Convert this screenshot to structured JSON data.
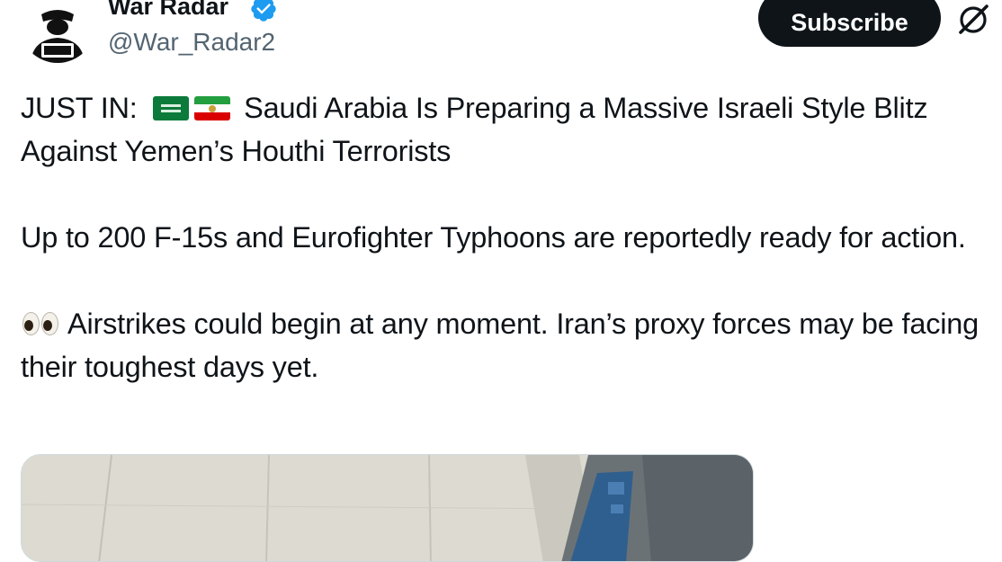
{
  "author": {
    "display_name": "War Radar",
    "handle": "@War_Radar2",
    "verified": true,
    "verified_color": "#1d9bf0",
    "avatar_icon": "hacker-hood-icon"
  },
  "actions": {
    "subscribe_label": "Subscribe",
    "grok_icon": "grok-icon"
  },
  "tweet": {
    "line1_prefix": "JUST IN:",
    "line1_flags": [
      "saudi-arabia-flag",
      "iran-flag"
    ],
    "line1_text": "Saudi Arabia Is Preparing a Massive Israeli Style Blitz Against Yemen’s Houthi Terrorists",
    "paragraph2": "Up to 200 F-15s and Eurofighter Typhoons are reportedly ready for action.",
    "paragraph3_emoji": "eyes-emoji",
    "paragraph3": "Airstrikes could begin at any moment. Iran’s proxy forces may be facing their toughest days yet."
  },
  "media": {
    "type": "photo"
  },
  "colors": {
    "text": "#0f1419",
    "secondary": "#536471",
    "button_bg": "#0f1419",
    "accent": "#1d9bf0"
  }
}
